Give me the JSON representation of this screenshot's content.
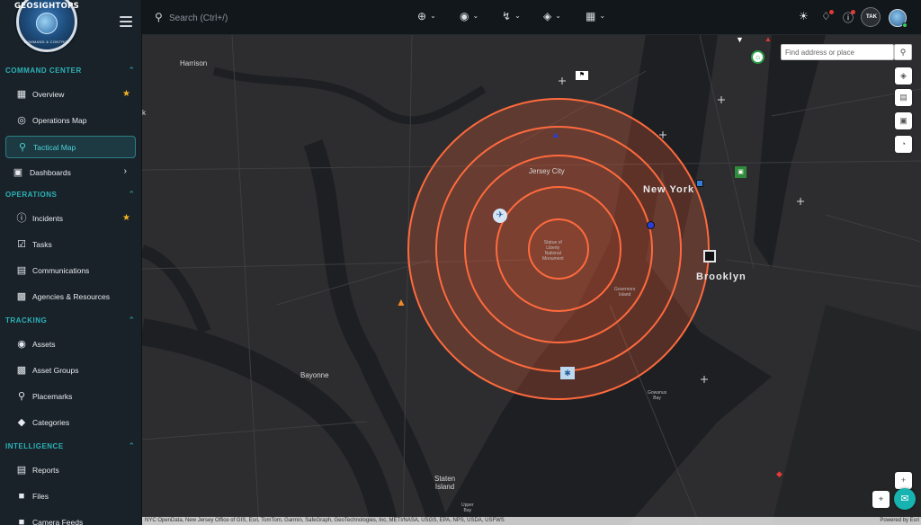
{
  "logo": {
    "text": "GEOSIGHTOPS",
    "subtitle": "COMMAND & CONTROL"
  },
  "sidebar": {
    "sections": [
      {
        "title": "COMMAND CENTER",
        "items": [
          {
            "label": "Overview",
            "icon": "grid-icon",
            "starred": true
          },
          {
            "label": "Operations Map",
            "icon": "globe-icon"
          },
          {
            "label": "Tactical Map",
            "icon": "pin-icon",
            "active": true
          },
          {
            "label": "Dashboards",
            "icon": "monitor-icon",
            "has_arrow": true
          }
        ]
      },
      {
        "title": "OPERATIONS",
        "items": [
          {
            "label": "Incidents",
            "icon": "alert-icon",
            "starred": true
          },
          {
            "label": "Tasks",
            "icon": "checklist-icon"
          },
          {
            "label": "Communications",
            "icon": "chat-icon"
          },
          {
            "label": "Agencies & Resources",
            "icon": "building-icon"
          }
        ]
      },
      {
        "title": "TRACKING",
        "items": [
          {
            "label": "Assets",
            "icon": "target-icon"
          },
          {
            "label": "Asset Groups",
            "icon": "group-icon"
          },
          {
            "label": "Placemarks",
            "icon": "placemark-icon"
          },
          {
            "label": "Categories",
            "icon": "tag-icon"
          }
        ]
      },
      {
        "title": "INTELLIGENCE",
        "items": [
          {
            "label": "Reports",
            "icon": "report-icon"
          },
          {
            "label": "Files",
            "icon": "folder-icon"
          },
          {
            "label": "Camera Feeds",
            "icon": "camera-icon"
          }
        ]
      }
    ]
  },
  "topbar": {
    "search_placeholder": "Search (Ctrl+/)",
    "tools": [
      "add-location-icon",
      "eye-icon",
      "route-icon",
      "layers-icon",
      "apps-grid-icon"
    ],
    "tak_label": "TAK"
  },
  "map": {
    "place_search_placeholder": "Find address or place",
    "labels": {
      "harrison": "Harrison",
      "jersey_city": "Jersey City",
      "new_york": "New York",
      "brooklyn": "Brooklyn",
      "bayonne": "Bayonne",
      "staten_island": "Staten\nIsland",
      "statue": "Statue of\nLiberty\nNational\nMonument",
      "governors": "Governors\nIsland",
      "gowanus": "Gowanus\nBay",
      "upper": "Upper\nBay",
      "edge_k": "k"
    },
    "range_ring_color": "#ff6a3d",
    "attribution": "NYC OpenData, New Jersey Office of GIS, Esri, TomTom, Garmin, SafeGraph, GeoTechnologies, Inc, METI/NASA, USGS, EPA, NPS, USDA, USFWS",
    "powered_by": "Powered by Esri"
  }
}
